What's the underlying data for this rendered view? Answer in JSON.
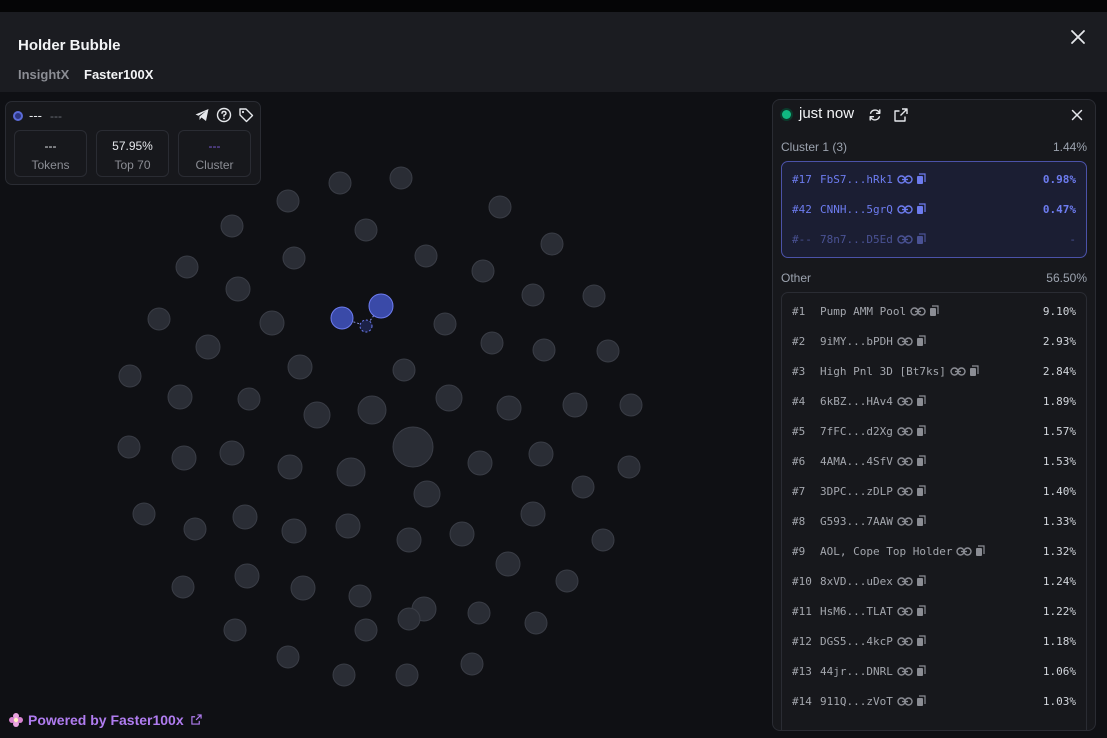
{
  "modal": {
    "title": "Holder Bubble",
    "tabs": [
      {
        "label": "InsightX",
        "active": false
      },
      {
        "label": "Faster100X",
        "active": true
      }
    ]
  },
  "stats": {
    "name": "---",
    "sub": "---",
    "tokens": {
      "value": "---",
      "label": "Tokens"
    },
    "top70": {
      "value": "57.95%",
      "label": "Top 70"
    },
    "cluster": {
      "value": "---",
      "label": "Cluster"
    },
    "icons": [
      "telegram-icon",
      "help-icon",
      "tag-icon"
    ]
  },
  "panel": {
    "time": "just now",
    "cluster": {
      "label": "Cluster 1 (3)",
      "pct": "1.44%",
      "rows": [
        {
          "rank": "#17",
          "addr": "FbS7...hRk1",
          "pct": "0.98%"
        },
        {
          "rank": "#42",
          "addr": "CNNH...5grQ",
          "pct": "0.47%"
        },
        {
          "rank": "#--",
          "addr": "78n7...D5Ed",
          "pct": "-"
        }
      ]
    },
    "other": {
      "label": "Other",
      "pct": "56.50%",
      "rows": [
        {
          "rank": "#1",
          "addr": "Pump AMM Pool",
          "pct": "9.10%"
        },
        {
          "rank": "#2",
          "addr": "9iMY...bPDH",
          "pct": "2.93%"
        },
        {
          "rank": "#3",
          "addr": "High Pnl 3D [Bt7ks]",
          "pct": "2.84%"
        },
        {
          "rank": "#4",
          "addr": "6kBZ...HAv4",
          "pct": "1.89%"
        },
        {
          "rank": "#5",
          "addr": "7fFC...d2Xg",
          "pct": "1.57%"
        },
        {
          "rank": "#6",
          "addr": "4AMA...4SfV",
          "pct": "1.53%"
        },
        {
          "rank": "#7",
          "addr": "3DPC...zDLP",
          "pct": "1.40%"
        },
        {
          "rank": "#8",
          "addr": "G593...7AAW",
          "pct": "1.33%"
        },
        {
          "rank": "#9",
          "addr": "AOL, Cope Top Holder",
          "pct": "1.32%"
        },
        {
          "rank": "#10",
          "addr": "8xVD...uDex",
          "pct": "1.24%"
        },
        {
          "rank": "#11",
          "addr": "HsM6...TLAT",
          "pct": "1.22%"
        },
        {
          "rank": "#12",
          "addr": "DGS5...4kcP",
          "pct": "1.18%"
        },
        {
          "rank": "#13",
          "addr": "44jr...DNRL",
          "pct": "1.06%"
        },
        {
          "rank": "#14",
          "addr": "911Q...zVoT",
          "pct": "1.03%"
        }
      ]
    }
  },
  "footer": {
    "powered_prefix": "Powered by ",
    "brand": "Faster100x"
  },
  "colors": {
    "accent": "#6d7cf0",
    "brand": "#b07cf0",
    "live": "#10b981",
    "bubble": "#2a2d35",
    "cluster_bubble": "#3a4aa8"
  }
}
